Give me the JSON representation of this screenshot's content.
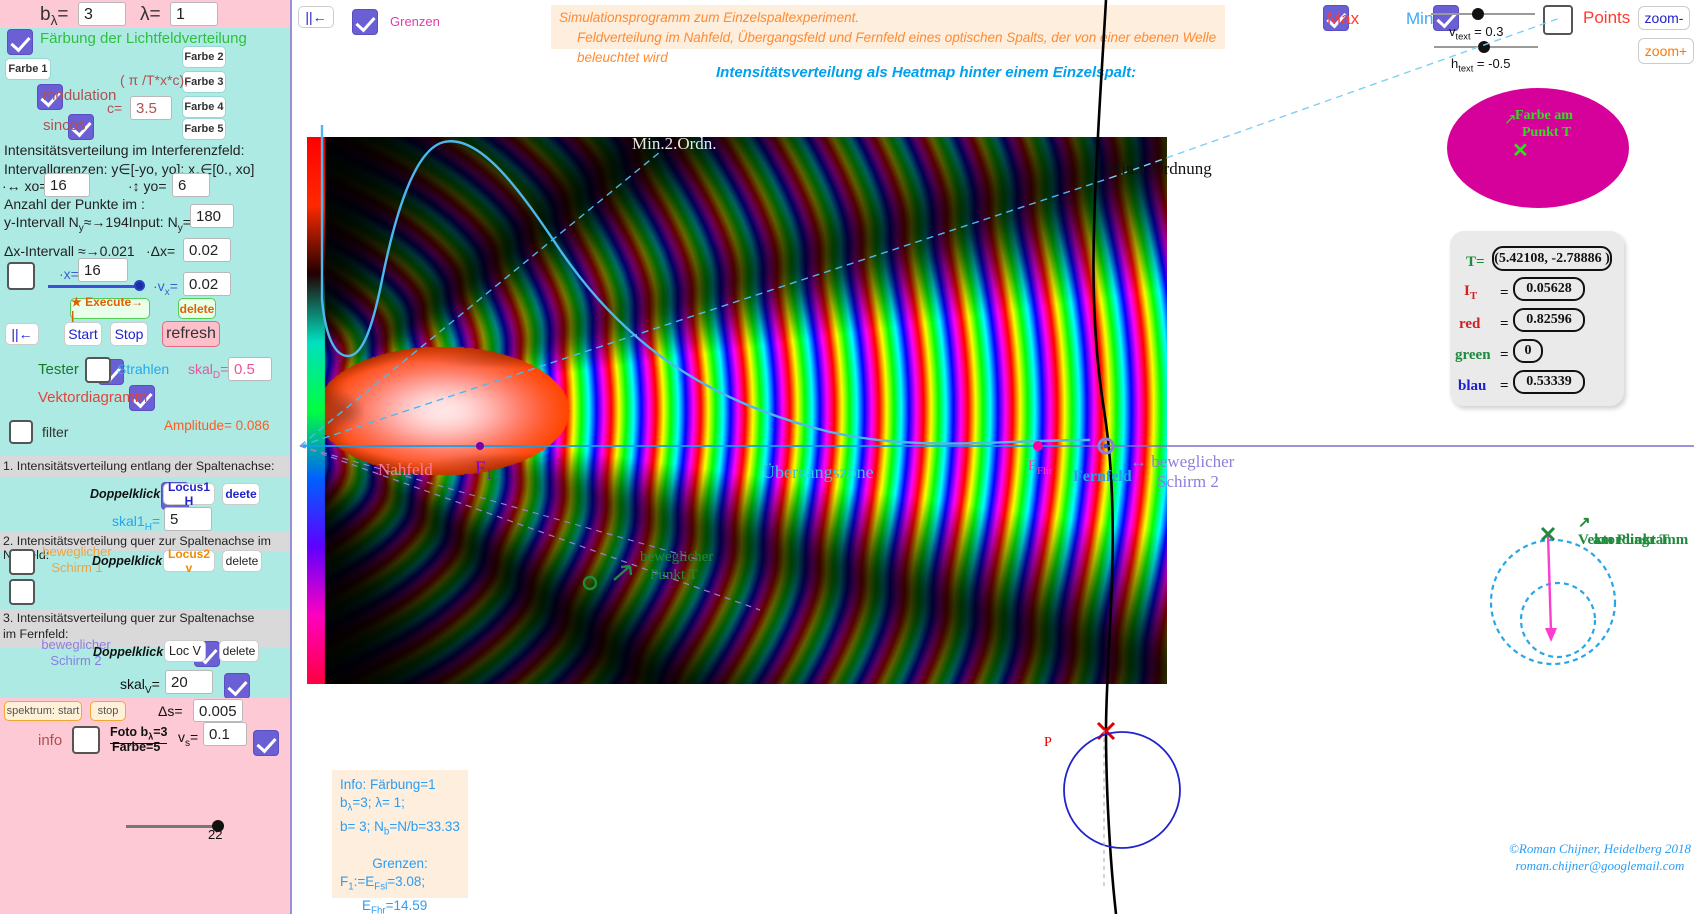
{
  "sidebar": {
    "top_params": {
      "b_label": "b",
      "b_sub": "λ",
      "b_eq": "=",
      "b_value": "3",
      "lambda_label": "λ=",
      "lambda_value": "1"
    },
    "faerbung_label": "Färbung der Lichtfeldverteilung",
    "farbe_buttons": [
      "Farbe 1",
      "Farbe 2",
      "Farbe 3",
      "Farbe 4",
      "Farbe 5"
    ],
    "formula": "( π /T*x*c);",
    "modulation_label": "modulation",
    "sincos_label": "sincos",
    "c_label": "c=",
    "c_value": "3.5",
    "intensity_heading": "Intensitätsverteilung im Interferenzfeld:",
    "interval_line": "Intervallgrenzen: y∈[-yo, yo]; x",
    "interval_line_sub": "c",
    "interval_line_rest": "∈[0., xo]",
    "xo_label": "·↔ xo=",
    "xo_value": "16",
    "yo_label": "·↕ yo=",
    "yo_value": "6",
    "points_heading": "Anzahl der Punkte im :",
    "ny_interval_label": "y-Intervall N",
    "ny_interval_sub": "y",
    "ny_interval_value": "≈→194",
    "ny_input_label": "·Input: N",
    "ny_input_sub": "y",
    "ny_input_eq": "=",
    "ny_value": "180",
    "dx_interval_label": "Δx-Intervall",
    "dx_interval_value": "≈→0.021",
    "dx_label": "·Δx=",
    "dx_value": "0.02",
    "x_label": "·x=",
    "x_value": "16",
    "vx_label": "·v",
    "vx_sub": "x",
    "vx_eq": "=",
    "vx_value": "0.02",
    "execute_label": "★ Execute→ |",
    "delete1_label": "delete",
    "pause_label": "||←",
    "start_label": "Start",
    "stop_label": "Stop",
    "refresh_label": "refresh",
    "tester_label": "Tester",
    "strahlen_label": "Strahlen",
    "skalD_label": "skal",
    "skalD_sub": "D",
    "skalD_eq": "=",
    "skalD_value": "0.5",
    "vektordiagramm_label": "Vektordiagramm",
    "filter_label": "filter",
    "amplitude_label": "Amplitude= 0.086",
    "section1_heading": "1. Intensitätsverteilung entlang der Spaltenachse:",
    "doppelklick_label": "Doppelklick→",
    "locus1_label": "Locus1 H",
    "deete_label": "deete",
    "skal1H_label": "skal1",
    "skal1H_sub": "H",
    "skal1H_eq": "=",
    "skal1H_value": "5",
    "section2_heading": "2. Intensitätsverteilung quer zur Spaltenachse im Nahfeld:",
    "schirm1_label_a": "beweglicher",
    "schirm1_label_b": "Schirm 1",
    "locus2_label": "Locus2 v",
    "delete2_label": "delete",
    "section3_heading_a": "3. Intensitätsverteilung quer zur Spaltenachse",
    "section3_heading_b": "im Fernfeld:",
    "schirm2_label_a": "beweglicher",
    "schirm2_label_b": "Schirm 2",
    "locv_label": "Loc V",
    "delete3_label": "delete",
    "skalV_label": "skal",
    "skalV_sub": "V",
    "skalV_eq": "=",
    "skalV_value": "20",
    "spektrum_start_label": "spektrum: start",
    "spektrum_stop_label": "stop",
    "ds_label": "Δs=",
    "ds_value": "0.005",
    "info_label": "info",
    "foto_label_a": "Foto b",
    "foto_label_a_sub": "λ",
    "foto_label_a_rest": "=3",
    "foto_label_b": "Farbe=5",
    "vs_label": "v",
    "vs_sub": "s",
    "vs_eq": "=",
    "vs_value": "0.1",
    "bottom_slider_value": "22"
  },
  "header": {
    "pause_label": "||←",
    "grenzen_label": "Grenzen",
    "title_line1": "Simulationsprogramm zum Einzelspaltexperiment.",
    "title_line2": "Feldverteilung im Nahfeld, Übergangsfeld und Fernfeld eines optischen Spalts, der von einer ebenen Welle beleuchtet wird",
    "heatmap_title": "Intensitätsverteilung als Heatmap hinter einem Einzelspalt:",
    "max_label": "Max",
    "min_label": "Min",
    "vtext_label": "v",
    "vtext_sub": "text",
    "vtext_eq": " = 0.3",
    "htext_label": "h",
    "htext_sub": "text",
    "htext_eq": " = -0.5",
    "points_label": "Points",
    "zoom_out_label": "zoom-",
    "zoom_in_label": "zoom+"
  },
  "plot_labels": {
    "min2": "Min.2.Ordn.",
    "min1": "Min.1.Ordnung",
    "nahfeld": "Nahfeld",
    "f1": "F",
    "f1_sub": "1",
    "uebergangszone": "Übergangszone",
    "efhr": "E",
    "efhr_sub": "Fhr",
    "fernfeld": "Fernfeld",
    "schirm2_a": "↔ beweglicher",
    "schirm2_b": "Schirm 2",
    "punktT_a": "beweglicher",
    "punktT_b": "Punkt T",
    "p_label": "P"
  },
  "color_disc": {
    "label_a": "Farbe am",
    "label_b": "Punkt T",
    "fill": "#d6009b",
    "marker": "✕"
  },
  "vector_diagram": {
    "label_a": "↗ Vektordiagramm",
    "label_b": "am Punkt T"
  },
  "data_box": {
    "t_label": "T=",
    "t_value": "(5.42108, -2.78886 )",
    "it_label": "I",
    "it_sub": "T",
    "it_eq": "=",
    "it_value": "0.05628",
    "red_label": "red",
    "red_eq": "=",
    "red_value": "0.82596",
    "green_label": "green",
    "green_eq": "=",
    "green_value": "0",
    "blau_label": "blau",
    "blau_eq": "=",
    "blau_value": "0.53339"
  },
  "info_box": {
    "l1": "Info: Färbung=1",
    "l2a": "b",
    "l2a_sub": "λ",
    "l2a_rest": "=3;  λ= 1;",
    "l3a": " b= 3; N",
    "l3a_sub": "b",
    "l3a_rest": "=N/b=33.33",
    "l4": "Grenzen:",
    "l5a": "F",
    "l5a_sub": "1",
    "l5a_mid": ":=E",
    "l5a_sub2": "Fsl",
    "l5a_rest": "=3.08;",
    "l6a": "E",
    "l6a_sub": "Fhr",
    "l6a_rest": "=14.59"
  },
  "footer": {
    "line1": "©Roman Chijner, Heidelberg 2018",
    "line2": "roman.chijner@googlemail.com"
  },
  "colors": {
    "sidebar_bg": "#aeeae4",
    "pink_band": "#fcc9d4",
    "accent_blue": "#00a0f0",
    "magenta": "#d6009b"
  }
}
